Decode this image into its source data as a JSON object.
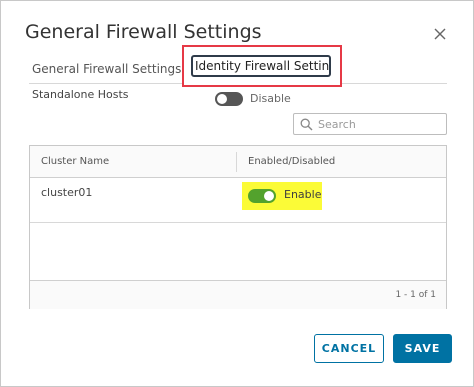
{
  "dialog": {
    "title": "General Firewall Settings",
    "close_icon": "close-icon"
  },
  "tabs": [
    {
      "label": "General Firewall Settings",
      "selected": false
    },
    {
      "label": "Identity Firewall Settings",
      "selected": true
    }
  ],
  "standalone": {
    "label": "Standalone Hosts",
    "toggle_state": "Disable",
    "toggle_on": false
  },
  "search": {
    "placeholder": "Search",
    "value": "",
    "icon": "search-icon"
  },
  "grid": {
    "columns": [
      "Cluster Name",
      "Enabled/Disabled"
    ],
    "rows": [
      {
        "cluster": "cluster01",
        "state": "Enable",
        "toggle_on": true
      }
    ],
    "pagination": "1 - 1 of 1"
  },
  "buttons": {
    "cancel": "CANCEL",
    "save": "SAVE"
  },
  "colors": {
    "accent": "#0072a3",
    "toggle_on": "#53a22d",
    "toggle_off": "#565656",
    "highlight": "#fbfb37",
    "annotation_box": "#e63946"
  }
}
